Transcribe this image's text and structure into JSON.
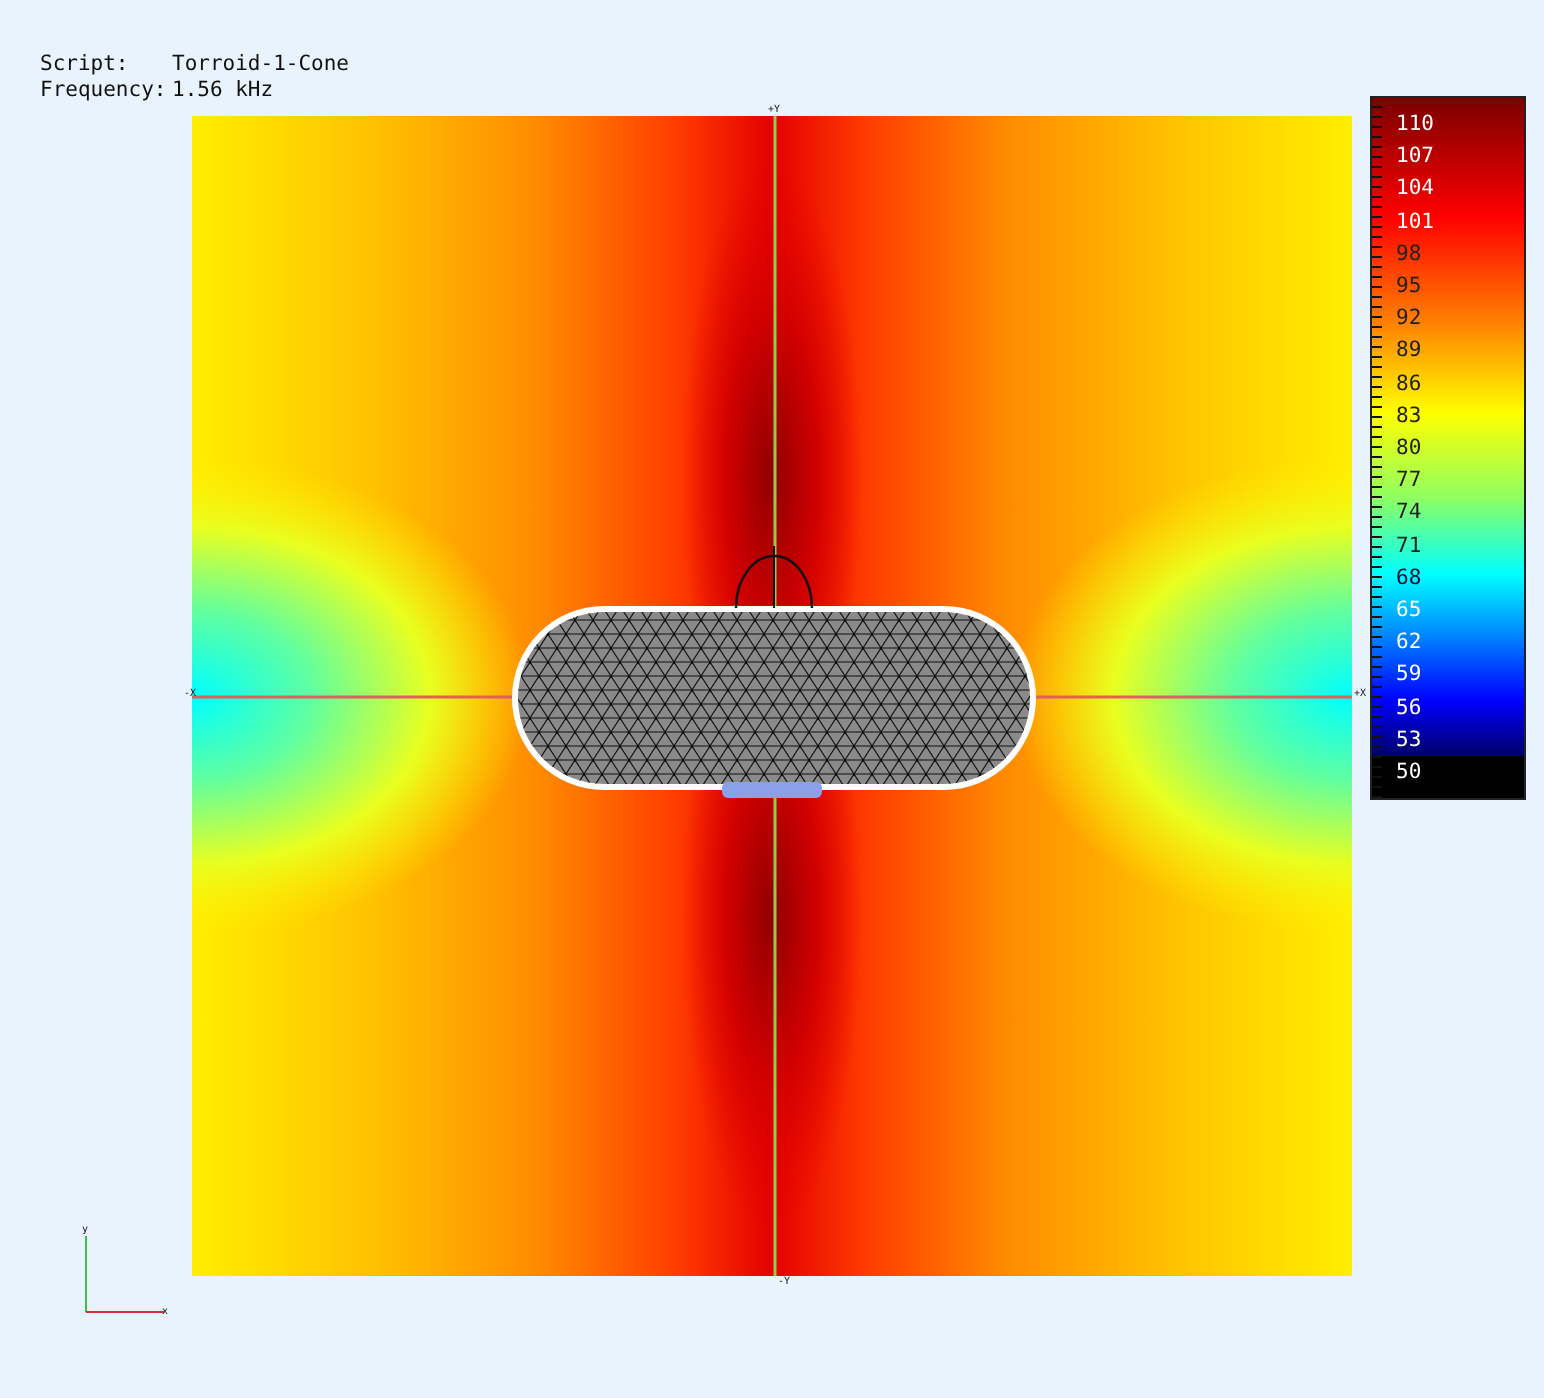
{
  "info": [
    {
      "label": "Script:",
      "value": "Torroid-1-Cone"
    },
    {
      "label": "Frequency:",
      "value": "1.56 kHz"
    }
  ],
  "plot": {
    "axis_labels": {
      "top": "+Y",
      "bottom": "-Y",
      "left": "-X",
      "right": "+X"
    }
  },
  "legend": {
    "labels": [
      "110",
      "107",
      "104",
      "101",
      "98",
      "95",
      "92",
      "89",
      "86",
      "83",
      "80",
      "77",
      "74",
      "71",
      "68",
      "65",
      "62",
      "59",
      "56",
      "53",
      "50"
    ]
  },
  "triad": {
    "vertical": "y",
    "horizontal": "x"
  }
}
